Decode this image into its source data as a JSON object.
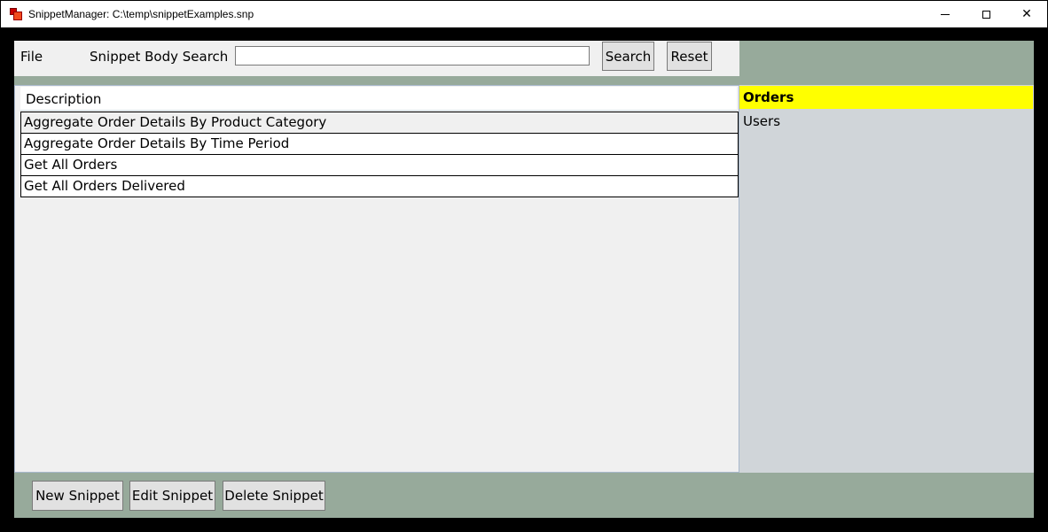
{
  "window": {
    "title": "SnippetManager: C:\\temp\\snippetExamples.snp",
    "minimize_symbol": "",
    "close_symbol": "✕"
  },
  "toolbar": {
    "file_label": "File",
    "search_label": "Snippet Body Search",
    "search_value": "",
    "search_placeholder": "",
    "search_button": "Search",
    "reset_button": "Reset"
  },
  "snippets": {
    "column_header": "Description",
    "rows": [
      "Aggregate Order Details By Product Category",
      "Aggregate Order Details By Time Period",
      "Get All Orders",
      "Get All Orders Delivered"
    ]
  },
  "categories": {
    "items": [
      "Orders",
      "Users"
    ],
    "selected": "Orders"
  },
  "footer": {
    "new_button": "New Snippet",
    "edit_button": "Edit Snippet",
    "delete_button": "Delete Snippet"
  },
  "colors": {
    "client_background": "#97aa9b",
    "selected_category": "#ffff00",
    "category_panel": "#d0d5d9",
    "list_panel": "#f0f0f0"
  }
}
